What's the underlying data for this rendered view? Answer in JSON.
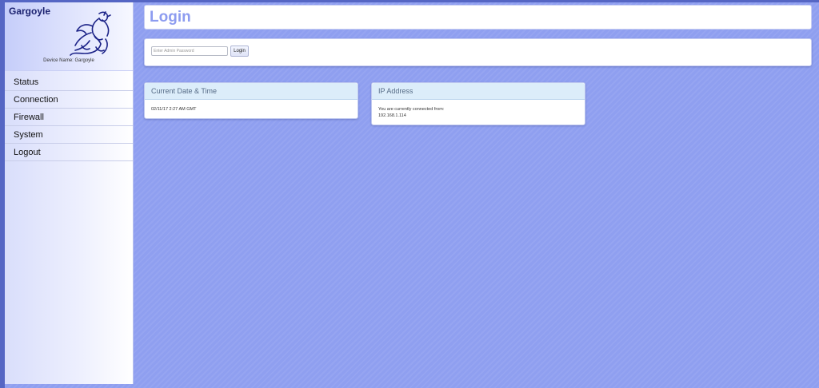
{
  "brand": {
    "name": "Gargoyle",
    "device_name": "Device Name: Gargoyle"
  },
  "nav": {
    "items": [
      "Status",
      "Connection",
      "Firewall",
      "System",
      "Logout"
    ]
  },
  "header": {
    "title": "Login"
  },
  "login": {
    "password_placeholder": "Enter Admin Password",
    "button_label": "Login"
  },
  "datetime_card": {
    "title": "Current Date & Time",
    "value": "02/11/17 2:27 AM GMT"
  },
  "ip_card": {
    "title": "IP Address",
    "text": "You are currently connected from:",
    "ip": "192.168.1.114"
  },
  "icons": {
    "logo": "gargoyle-logo-icon"
  },
  "colors": {
    "background": "#8f9ff0",
    "accent": "#8d9cf0",
    "brand_text": "#1b2270",
    "card_header": "#dcedfa"
  }
}
